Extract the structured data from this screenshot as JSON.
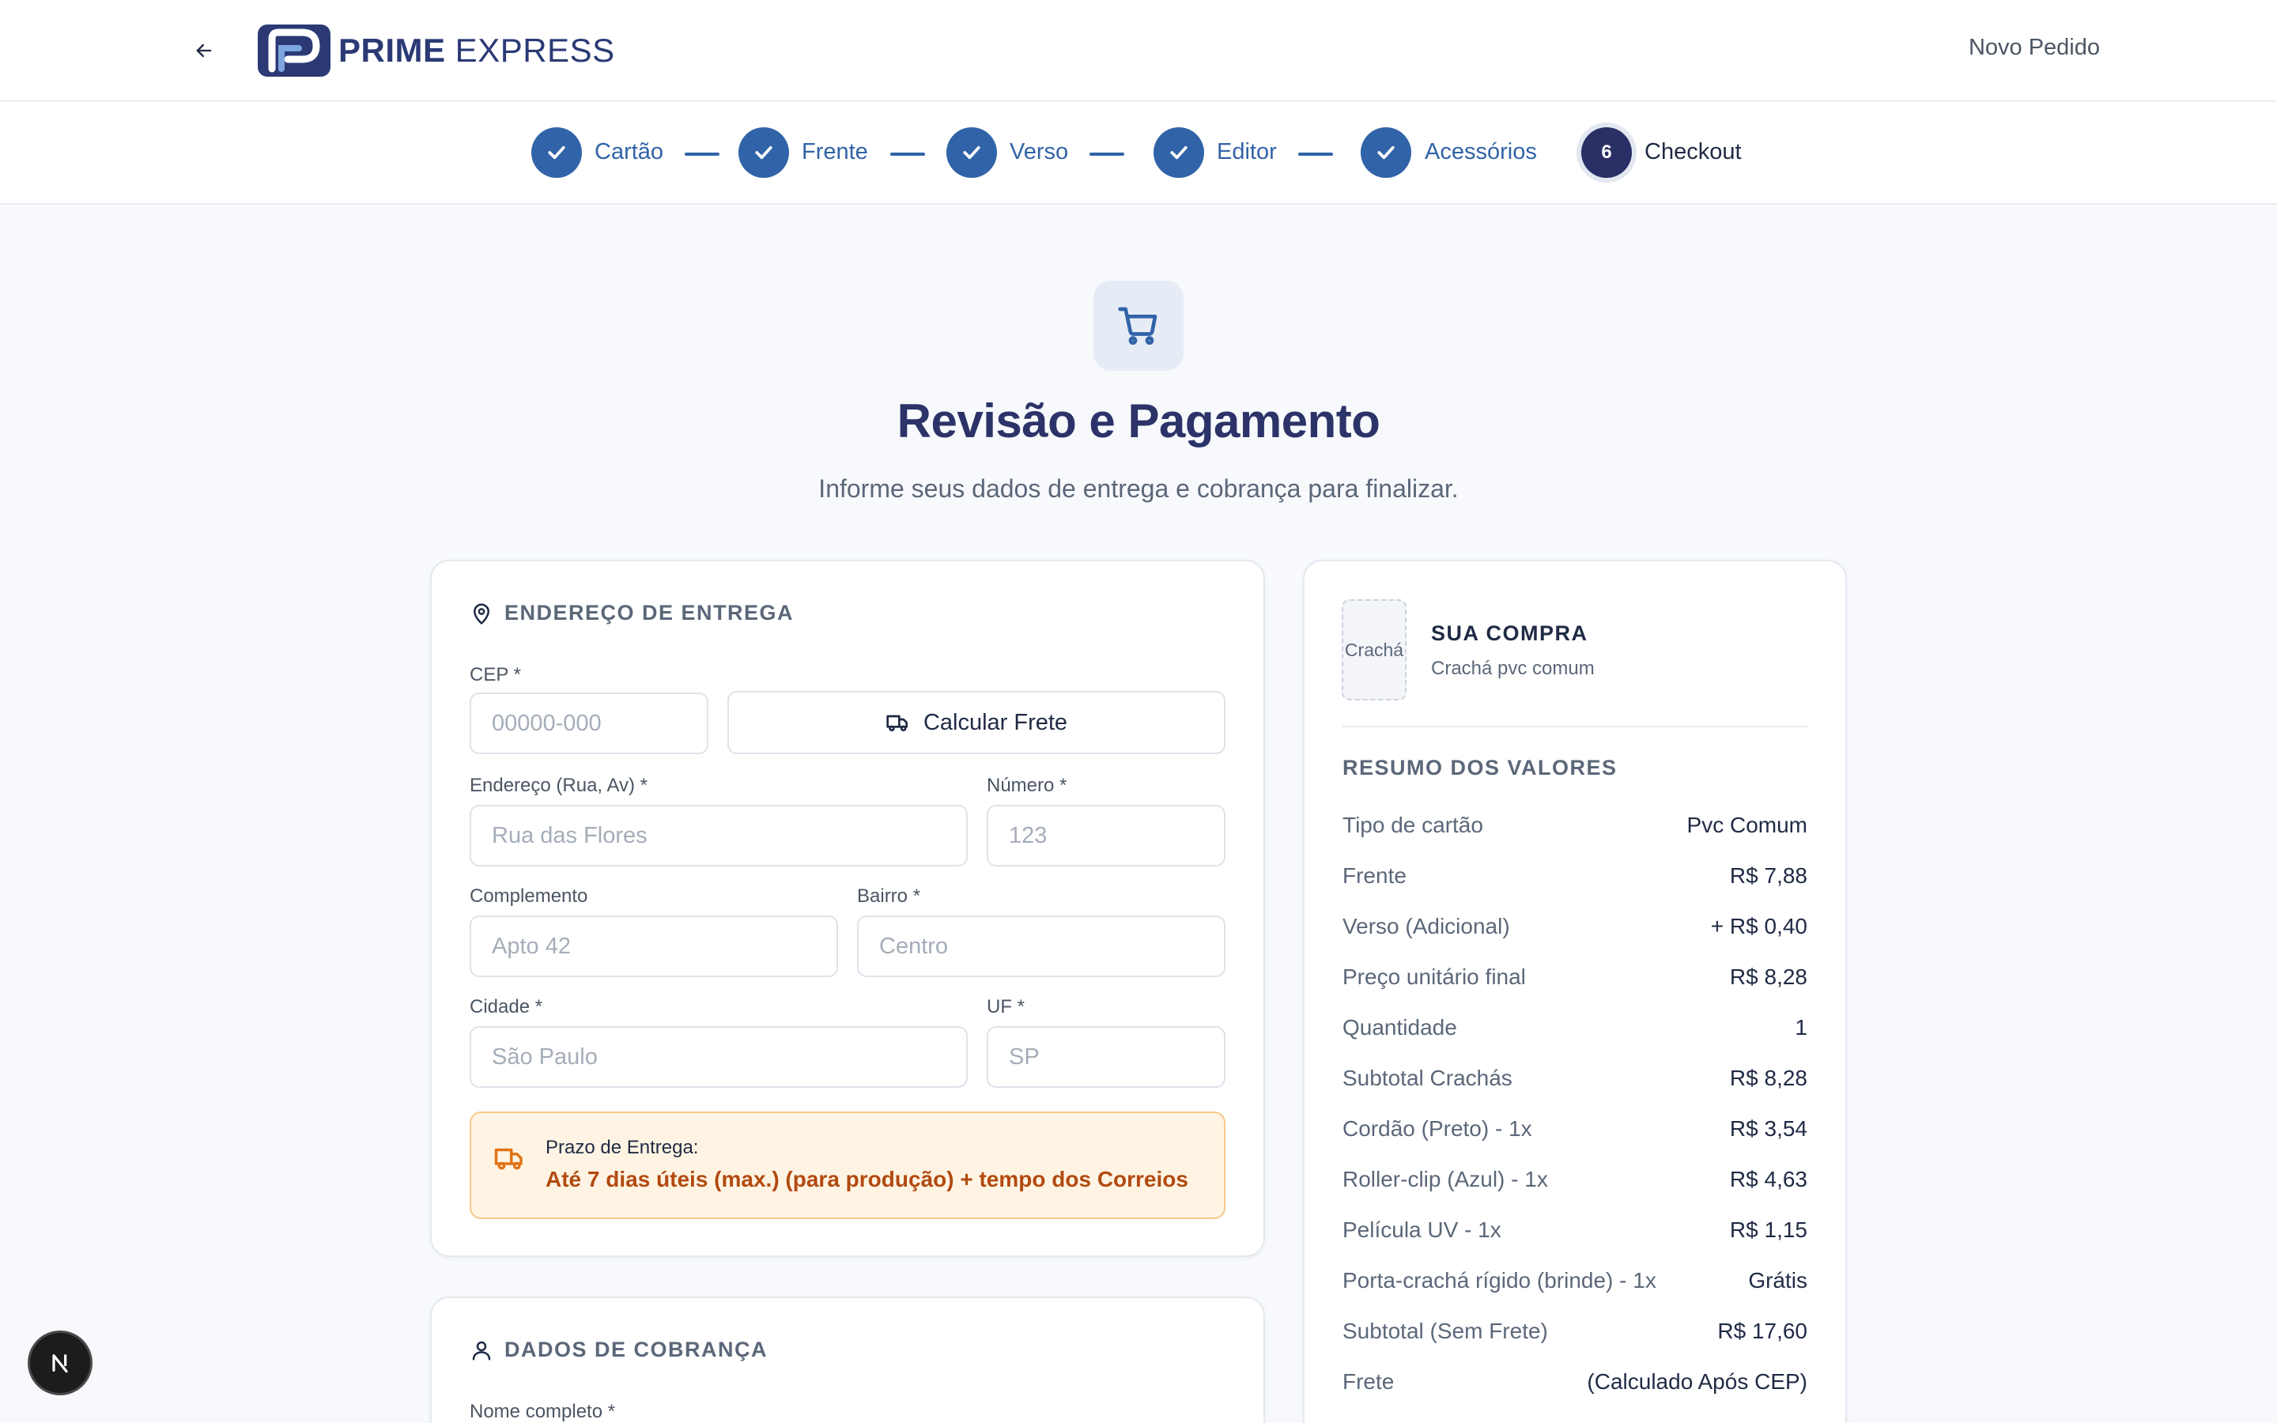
{
  "header": {
    "brand_bold": "PRIME",
    "brand_light": " EXPRESS",
    "new_order": "Novo Pedido"
  },
  "steps": [
    {
      "label": "Cartão",
      "status": "done"
    },
    {
      "label": "Frente",
      "status": "done"
    },
    {
      "label": "Verso",
      "status": "done"
    },
    {
      "label": "Editor",
      "status": "done"
    },
    {
      "label": "Acessórios",
      "status": "done"
    },
    {
      "label": "Checkout",
      "status": "active",
      "number": "6"
    }
  ],
  "hero": {
    "title": "Revisão e Pagamento",
    "subtitle": "Informe seus dados de entrega e cobrança para finalizar."
  },
  "address": {
    "heading": "ENDEREÇO DE ENTREGA",
    "cep": {
      "label": "CEP *",
      "placeholder": "00000-000",
      "value": ""
    },
    "calc_button": "Calcular Frete",
    "street": {
      "label": "Endereço (Rua, Av) *",
      "placeholder": "Rua das Flores",
      "value": ""
    },
    "number": {
      "label": "Número *",
      "placeholder": "123",
      "value": ""
    },
    "complement": {
      "label": "Complemento",
      "placeholder": "Apto 42",
      "value": ""
    },
    "district": {
      "label": "Bairro *",
      "placeholder": "Centro",
      "value": ""
    },
    "city": {
      "label": "Cidade *",
      "placeholder": "São Paulo",
      "value": ""
    },
    "state": {
      "label": "UF *",
      "placeholder": "SP",
      "value": ""
    },
    "delivery_title": "Prazo de Entrega:",
    "delivery_text": "Até 7 dias úteis (max.) (para produção) + tempo dos Correios"
  },
  "billing": {
    "heading": "DADOS DE COBRANÇA",
    "name_label": "Nome completo *"
  },
  "summary": {
    "thumb_label": "Crachá",
    "title": "SUA COMPRA",
    "subtitle": "Crachá pvc comum",
    "section": "RESUMO DOS VALORES",
    "rows": [
      {
        "k": "Tipo de cartão",
        "v": "Pvc Comum"
      },
      {
        "k": "Frente",
        "v": "R$ 7,88"
      },
      {
        "k": "Verso (Adicional)",
        "v": "+ R$ 0,40"
      },
      {
        "k": "Preço unitário final",
        "v": "R$ 8,28"
      },
      {
        "k": "Quantidade",
        "v": "1"
      },
      {
        "k": "Subtotal Crachás",
        "v": "R$ 8,28"
      },
      {
        "k": "Cordão (Preto) - 1x",
        "v": "R$ 3,54"
      },
      {
        "k": "Roller-clip (Azul) - 1x",
        "v": "R$ 4,63"
      },
      {
        "k": "Película UV - 1x",
        "v": "R$ 1,15"
      },
      {
        "k": "Porta-crachá rígido (brinde) - 1x",
        "v": "Grátis"
      },
      {
        "k": "Subtotal (Sem Frete)",
        "v": "R$ 17,60"
      },
      {
        "k": "Frete",
        "v": "(Calculado Após CEP)"
      }
    ]
  },
  "colors": {
    "primary": "#3163a8",
    "navy": "#2b3368",
    "warning_bg": "#fff4e3",
    "warning_text": "#b24a10"
  }
}
